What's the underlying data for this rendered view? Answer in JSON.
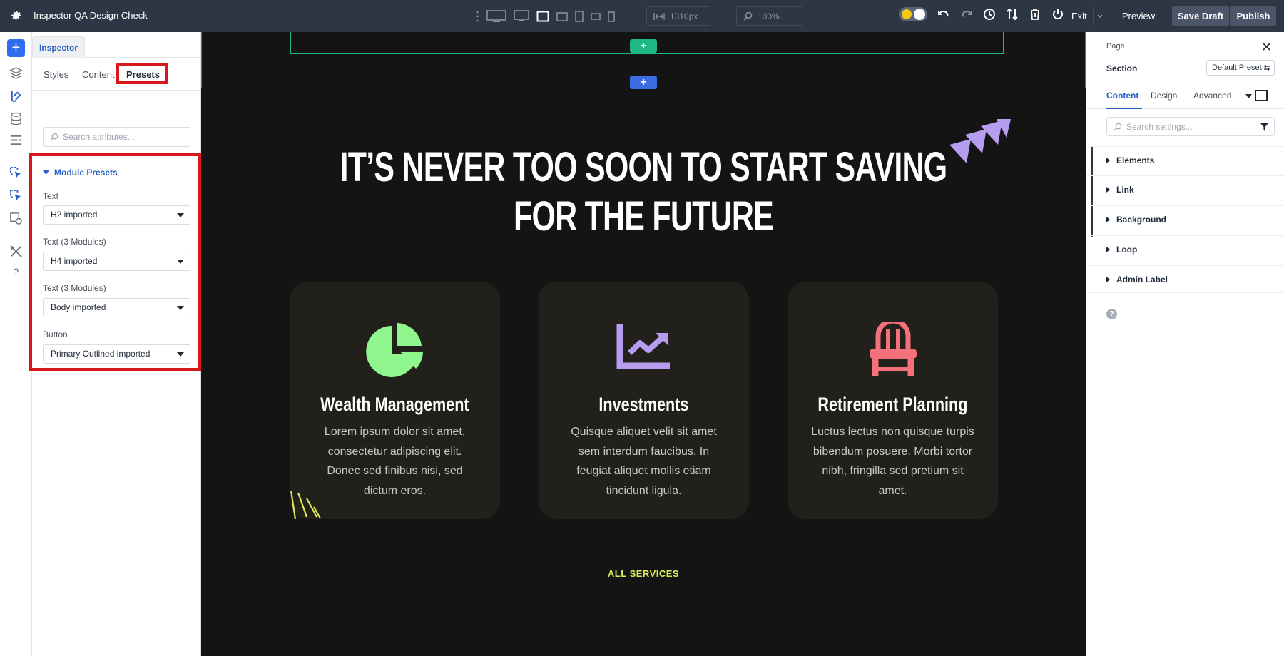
{
  "topbar": {
    "title": "Inspector QA Design Check",
    "width_field": "1310px",
    "zoom_field": "100%",
    "exit_label": "Exit",
    "preview_label": "Preview",
    "save_draft_label": "Save Draft",
    "publish_label": "Publish"
  },
  "inspector": {
    "tab_label": "Inspector",
    "subtabs": [
      "Styles",
      "Content",
      "Presets"
    ],
    "search_placeholder": "Search attributes...",
    "module_presets_title": "Module Presets",
    "presets": [
      {
        "label": "Text",
        "value": "H2 imported"
      },
      {
        "label": "Text (3 Modules)",
        "value": "H4 imported"
      },
      {
        "label": "Text (3 Modules)",
        "value": "Body imported"
      },
      {
        "label": "Button",
        "value": "Primary Outlined imported"
      }
    ]
  },
  "canvas": {
    "add_symbol": "+",
    "headline_line1": "IT’S NEVER TOO SOON TO START SAVING",
    "headline_line2": "FOR THE FUTURE",
    "cards": [
      {
        "icon": "pie-chart-icon",
        "icon_color": "#8ef68c",
        "title": "Wealth Management",
        "body": "Lorem ipsum dolor sit amet, consectetur adipiscing elit. Donec sed finibus nisi, sed dictum eros."
      },
      {
        "icon": "trend-chart-icon",
        "icon_color": "#b79df0",
        "title": "Investments",
        "body": "Quisque aliquet velit sit amet sem interdum faucibus. In feugiat aliquet mollis etiam tincidunt ligula."
      },
      {
        "icon": "chair-icon",
        "icon_color": "#f4717b",
        "title": "Retirement Planning",
        "body": "Luctus lectus non quisque turpis bibendum posuere. Morbi tortor nibh, fringilla sed pretium sit amet."
      }
    ],
    "all_services_label": "ALL SERVICES"
  },
  "settings": {
    "page_label": "Page",
    "section_label": "Section",
    "preset_button": "Default Preset",
    "tabs": [
      "Content",
      "Design",
      "Advanced"
    ],
    "search_placeholder": "Search settings...",
    "accordion": [
      "Elements",
      "Link",
      "Background",
      "Loop",
      "Admin Label"
    ],
    "help_symbol": "?"
  },
  "colors": {
    "topbar_bg": "#2d3643",
    "accent_blue": "#2761c4",
    "highlight_red": "#d7191d",
    "add_green": "#1fb885",
    "add_blue": "#3b6de0",
    "link_yellow": "#dbeb55",
    "decor_purple": "#b79df0"
  }
}
